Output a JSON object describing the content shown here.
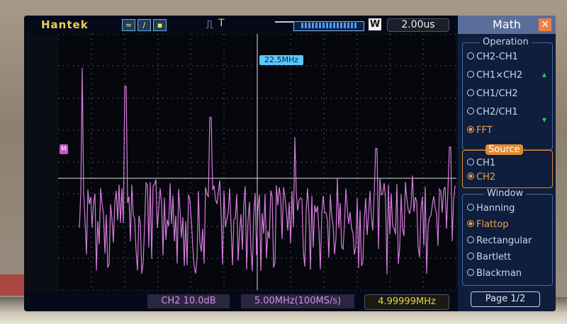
{
  "header": {
    "brand": "Hantek",
    "timebase": "2.00us",
    "window_mode": "W",
    "fft_marker": "22.5MHz",
    "channel_marker": "M"
  },
  "status": {
    "scale": "CH2 10.0dB",
    "rate": "5.00MHz(100MS/s)",
    "frequency": "4.99999MHz"
  },
  "menu": {
    "title": "Math",
    "operation": {
      "label": "Operation",
      "options": [
        "CH2-CH1",
        "CH1×CH2",
        "CH1/CH2",
        "CH2/CH1",
        "FFT"
      ],
      "selected": "FFT"
    },
    "source": {
      "label": "Source",
      "options": [
        "CH1",
        "CH2"
      ],
      "selected": "CH2"
    },
    "window": {
      "label": "Window",
      "options": [
        "Hanning",
        "Flattop",
        "Rectangular",
        "Bartlett",
        "Blackman"
      ],
      "selected": "Flattop"
    },
    "page": "Page 1/2"
  },
  "colors": {
    "trace": "#d77bdc",
    "brand": "#e8d25a",
    "accent": "#f0a050",
    "menu_bg": "#0e1e3c"
  }
}
